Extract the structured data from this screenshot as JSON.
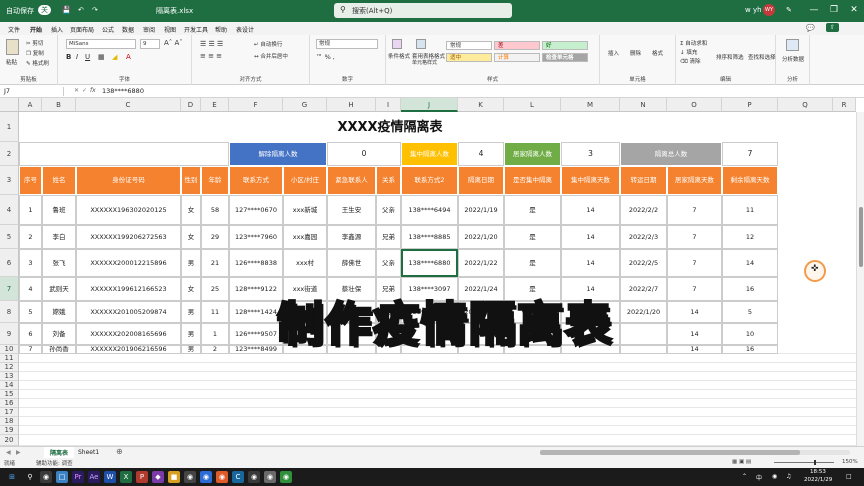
{
  "titlebar": {
    "autosave": "自动保存",
    "autosave_state": "关",
    "filename": "隔离表.xlsx",
    "search_placeholder": "搜索(Alt+Q)",
    "user": "w yh",
    "avatar": "WY"
  },
  "menu": [
    "文件",
    "开始",
    "插入",
    "页面布局",
    "公式",
    "数据",
    "审阅",
    "视图",
    "开发工具",
    "帮助",
    "表设计"
  ],
  "ribbon": {
    "paste": "粘贴",
    "cut": "剪切",
    "copy": "复制",
    "format_painter": "格式刷",
    "clipboard": "剪贴板",
    "font_name": "MiSans",
    "font_size": "9",
    "font": "字体",
    "wrap": "自动换行",
    "merge": "合并后居中",
    "alignment": "对齐方式",
    "number_format": "常规",
    "number": "数字",
    "cond_format": "条件格式",
    "table_format": "套用表格格式",
    "cell_styles": "单元格样式",
    "style_normal": "常规",
    "style_bad": "差",
    "style_good": "好",
    "style_neutral": "适中",
    "style_calc": "计算",
    "style_check": "检查单元格",
    "styles": "样式",
    "insert": "插入",
    "delete": "删除",
    "format": "格式",
    "cells": "单元格",
    "autosum": "自动求和",
    "fill": "填充",
    "clear": "清除",
    "sort": "排序和筛选",
    "find": "查找和选择",
    "editing": "编辑",
    "analyze": "分析数据",
    "analysis": "分析"
  },
  "formula_bar": {
    "cell_ref": "J7",
    "fx": "fx",
    "value": "138****6880"
  },
  "columns": [
    "A",
    "B",
    "C",
    "D",
    "E",
    "F",
    "G",
    "H",
    "I",
    "J",
    "K",
    "L",
    "M",
    "N",
    "O",
    "P",
    "Q",
    "R"
  ],
  "rows": [
    "1",
    "2",
    "3",
    "4",
    "5",
    "6",
    "7",
    "8",
    "9",
    "10",
    "11",
    "12",
    "13",
    "14",
    "15",
    "16",
    "17",
    "18",
    "19",
    "20"
  ],
  "sheet": {
    "title": "XXXX疫情隔离表",
    "summary": [
      {
        "label": "解除隔离人数",
        "value": "0",
        "color": "#4472c4"
      },
      {
        "label": "集中隔离人数",
        "value": "4",
        "color": "#ffc000"
      },
      {
        "label": "居家隔离人数",
        "value": "3",
        "color": "#70ad47"
      },
      {
        "label": "隔离总人数",
        "value": "7",
        "color": "#a5a5a5"
      }
    ],
    "headers": [
      "序号",
      "姓名",
      "身份证号码",
      "性别",
      "年龄",
      "联系方式",
      "小区/村庄",
      "紧急联系人",
      "关系",
      "联系方式2",
      "隔离日期",
      "是否集中隔离",
      "集中隔离天数",
      "转运日期",
      "居家隔离天数",
      "剩余隔离天数"
    ],
    "data": [
      [
        "1",
        "鲁班",
        "XXXXXX196302020125",
        "女",
        "58",
        "127****0670",
        "xxx新城",
        "王生安",
        "父亲",
        "138****6494",
        "2022/1/19",
        "是",
        "14",
        "2022/2/2",
        "7",
        "11"
      ],
      [
        "2",
        "李白",
        "XXXXXX199206272563",
        "女",
        "29",
        "123****7960",
        "xxx嘉园",
        "李鑫源",
        "兄弟",
        "138****8885",
        "2022/1/20",
        "是",
        "14",
        "2022/2/3",
        "7",
        "12"
      ],
      [
        "3",
        "张飞",
        "XXXXXX200012215896",
        "男",
        "21",
        "126****8838",
        "xxx村",
        "薛佛世",
        "父亲",
        "138****6880",
        "2022/1/22",
        "是",
        "14",
        "2022/2/5",
        "7",
        "14"
      ],
      [
        "4",
        "武则天",
        "XXXXXX199612166523",
        "女",
        "25",
        "128****9122",
        "xxx街道",
        "蔡壮保",
        "兄弟",
        "138****3097",
        "2022/1/24",
        "是",
        "14",
        "2022/2/7",
        "7",
        "16"
      ],
      [
        "5",
        "嫦娥",
        "XXXXXX201005209874",
        "男",
        "11",
        "128****1424",
        "xxx小区",
        "小红",
        "兄弟",
        "138****5866",
        "2022/1/20",
        "否",
        "0",
        "2022/1/20",
        "14",
        "5"
      ],
      [
        "6",
        "刘备",
        "XXXXXX202008165696",
        "男",
        "1",
        "126****9507",
        "",
        "",
        "",
        "",
        "",
        "",
        "",
        "",
        "14",
        "10"
      ],
      [
        "7",
        "孙尚香",
        "XXXXXX201906216596",
        "男",
        "2",
        "123****8499",
        "",
        "",
        "",
        "",
        "",
        "",
        "",
        "",
        "14",
        "16"
      ]
    ]
  },
  "overlay_text": "制作疫情隔离表",
  "tabs": [
    "隔离表",
    "Sheet1"
  ],
  "status": {
    "ready": "就绪",
    "accessibility": "辅助功能: 调查",
    "zoom": "150%"
  },
  "taskbar": {
    "time": "18:53",
    "date": "2022/1/29",
    "ime": "中"
  }
}
